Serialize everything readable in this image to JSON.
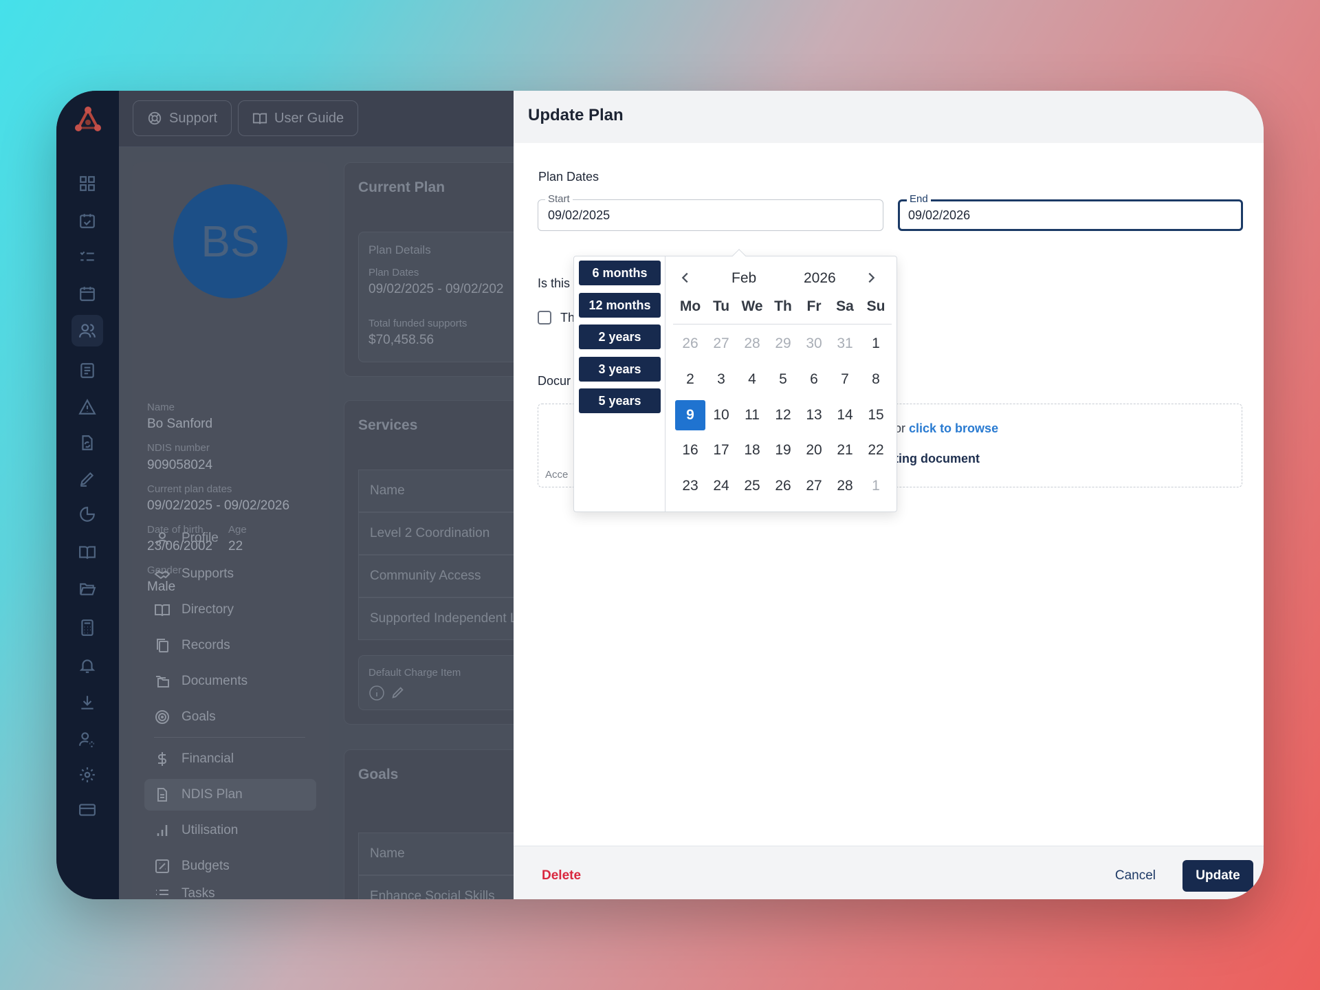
{
  "topbar": {
    "support_label": "Support",
    "guide_label": "User Guide"
  },
  "profile": {
    "initials": "BS",
    "name_label": "Name",
    "name": "Bo Sanford",
    "ndis_label": "NDIS number",
    "ndis": "909058024",
    "plan_dates_label": "Current plan dates",
    "plan_dates": "09/02/2025 - 09/02/2026",
    "dob_label": "Date of birth",
    "dob": "23/06/2002",
    "age_label": "Age",
    "age": "22",
    "gender_label": "Gender",
    "gender": "Male"
  },
  "side_nav": [
    {
      "label": "Profile",
      "icon": "user-icon"
    },
    {
      "label": "Supports",
      "icon": "handshake-icon"
    },
    {
      "label": "Directory",
      "icon": "book-open-icon"
    },
    {
      "label": "Records",
      "icon": "copy-icon"
    },
    {
      "label": "Documents",
      "icon": "folders-icon"
    },
    {
      "label": "Goals",
      "icon": "target-icon"
    },
    {
      "label": "Financial",
      "icon": "dollar-icon"
    },
    {
      "label": "NDIS Plan",
      "icon": "file-icon"
    },
    {
      "label": "Utilisation",
      "icon": "bar-chart-icon"
    },
    {
      "label": "Budgets",
      "icon": "percent-icon"
    },
    {
      "label": "Tasks",
      "icon": "list-icon"
    }
  ],
  "current_plan": {
    "title": "Current Plan",
    "details_label": "Plan Details",
    "dates_label": "Plan Dates",
    "dates": "09/02/2025 - 09/02/202",
    "funded_label": "Total funded supports",
    "funded": "$70,458.56"
  },
  "services": {
    "title": "Services",
    "col_name": "Name",
    "rows": [
      "Level 2 Coordination",
      "Community Access",
      "Supported Independent L"
    ],
    "default_charge_label": "Default Charge Item"
  },
  "goals": {
    "title": "Goals",
    "col_name": "Name",
    "rows": [
      "Enhance Social Skills"
    ]
  },
  "modal": {
    "title": "Update Plan",
    "plan_dates_label": "Plan Dates",
    "start_legend": "Start",
    "start_value": "09/02/2025",
    "end_legend": "End",
    "end_value": "09/02/2026",
    "is_this_label": "Is this",
    "checkbox_text": "Th",
    "documents_label": "Docur",
    "drop_text_suffix": "or",
    "browse_link": "click to browse",
    "supporting_text": "ting document",
    "accepted_text": "Acce",
    "delete_label": "Delete",
    "cancel_label": "Cancel",
    "update_label": "Update"
  },
  "date_picker": {
    "presets": [
      "6 months",
      "12 months",
      "2 years",
      "3 years",
      "5 years"
    ],
    "month": "Feb",
    "year": "2026",
    "weekdays": [
      "Mo",
      "Tu",
      "We",
      "Th",
      "Fr",
      "Sa",
      "Su"
    ],
    "weeks": [
      [
        "26",
        "27",
        "28",
        "29",
        "30",
        "31",
        "1"
      ],
      [
        "2",
        "3",
        "4",
        "5",
        "6",
        "7",
        "8"
      ],
      [
        "9",
        "10",
        "11",
        "12",
        "13",
        "14",
        "15"
      ],
      [
        "16",
        "17",
        "18",
        "19",
        "20",
        "21",
        "22"
      ],
      [
        "23",
        "24",
        "25",
        "26",
        "27",
        "28",
        "1"
      ]
    ],
    "selected_day": "9"
  },
  "colors": {
    "accent": "#172a4e",
    "selected": "#1f73d0",
    "danger": "#d9283f",
    "link": "#2a7bd1"
  }
}
